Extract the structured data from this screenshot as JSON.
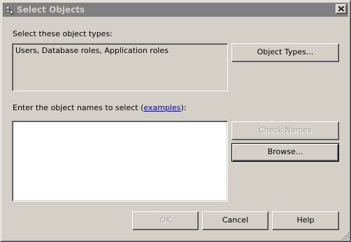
{
  "dialog": {
    "title": "Select Objects",
    "close_glyph": "✕"
  },
  "object_types": {
    "label": "Select these object types:",
    "value": "Users, Database roles, Application roles",
    "button_label": "Object Types..."
  },
  "object_names": {
    "label_prefix": "Enter the object names to select (",
    "link_text": "examples",
    "label_suffix": "):",
    "value": "",
    "check_names_label": "Check Names",
    "browse_label": "Browse..."
  },
  "footer": {
    "ok_label": "OK",
    "cancel_label": "Cancel",
    "help_label": "Help"
  },
  "colors": {
    "dialog_bg": "#d4d0c8",
    "titlebar_inactive": "#808080",
    "link": "#0000cc",
    "disabled_text": "#a0a0a0"
  },
  "icons": {
    "title_icon": "select-objects-icon",
    "close_icon": "close-icon",
    "resize_grip": "resize-grip-icon"
  }
}
